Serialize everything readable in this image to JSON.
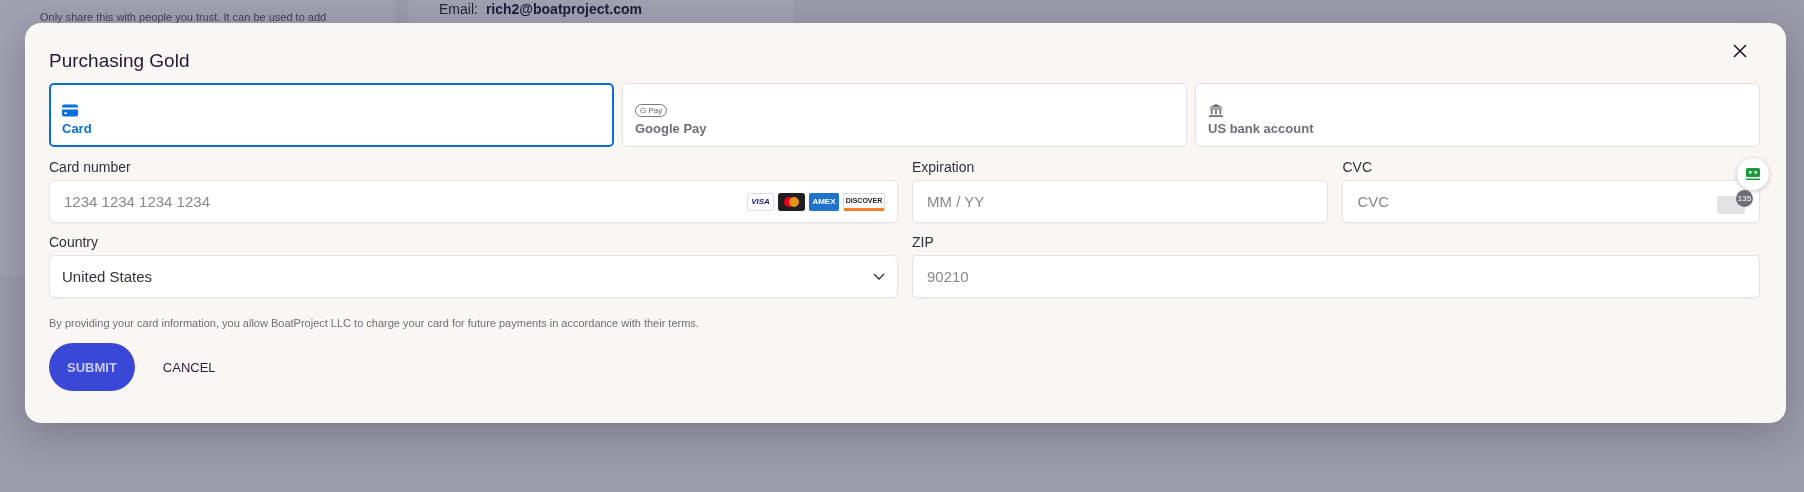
{
  "background": {
    "notice": "Only share this with people you trust. It can be used to add",
    "email_label": "Email:",
    "email": "rich2@boatproject.com"
  },
  "dialog": {
    "title": "Purchasing Gold",
    "payment_methods": [
      {
        "kind": "card",
        "label": "Card",
        "selected": true
      },
      {
        "kind": "gpay",
        "label": "Google Pay",
        "logo": "G Pay",
        "selected": false
      },
      {
        "kind": "bank",
        "label": "US bank account",
        "selected": false
      }
    ],
    "fields": [
      {
        "kind": "card_number",
        "label": "Card number",
        "placeholder": "1234 1234 1234 1234",
        "brands": [
          {
            "kind": "visa",
            "label": "VISA"
          },
          {
            "kind": "mastercard"
          },
          {
            "kind": "amex",
            "label": "AMEX"
          },
          {
            "kind": "discover",
            "label": "DISCOVER"
          }
        ]
      },
      {
        "kind": "text",
        "label": "Expiration",
        "placeholder": "MM / YY"
      },
      {
        "kind": "cvc",
        "label": "CVC",
        "placeholder": "CVC",
        "badge": "135"
      },
      {
        "kind": "select",
        "label": "Country",
        "value": "United States"
      },
      {
        "kind": "wide",
        "label": "ZIP",
        "placeholder": "90210"
      }
    ],
    "terms": "By providing your card information, you allow BoatProject LLC to charge your card for future payments in accordance with their terms.",
    "buttons": [
      {
        "kind": "primary",
        "label": "SUBMIT"
      },
      {
        "kind": "text",
        "label": "CANCEL"
      }
    ]
  }
}
